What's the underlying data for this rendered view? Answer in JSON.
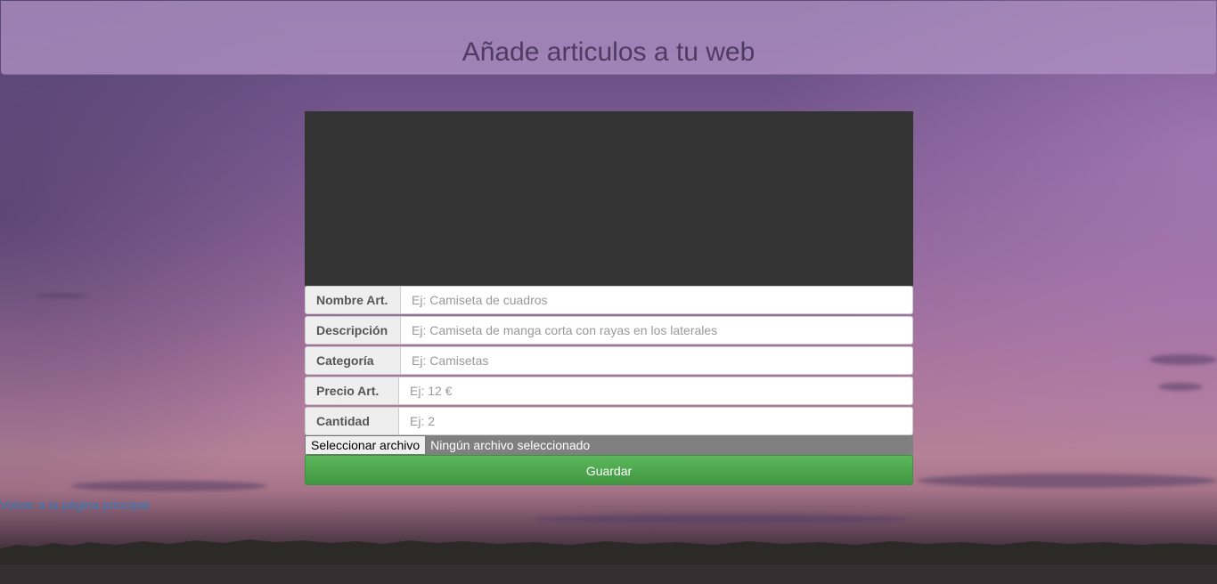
{
  "header": {
    "title": "Añade articulos a tu web"
  },
  "form": {
    "fields": [
      {
        "label": "Nombre Art.",
        "placeholder": "Ej: Camiseta de cuadros"
      },
      {
        "label": "Descripción",
        "placeholder": "Ej: Camiseta de manga corta con rayas en los laterales"
      },
      {
        "label": "Categoría",
        "placeholder": "Ej: Camisetas"
      },
      {
        "label": "Precio Art.",
        "placeholder": "Ej: 12 €"
      },
      {
        "label": "Cantidad",
        "placeholder": "Ej: 2"
      }
    ],
    "file": {
      "button_label": "Seleccionar archivo",
      "status": "Ningún archivo seleccionado"
    },
    "save_label": "Guardar"
  },
  "footer": {
    "back_link": "Volver a la página principal"
  },
  "colors": {
    "header_text": "#4f3b62",
    "save_button": "#5cb85c",
    "link": "#337ab7",
    "preview_bg": "#333333"
  }
}
